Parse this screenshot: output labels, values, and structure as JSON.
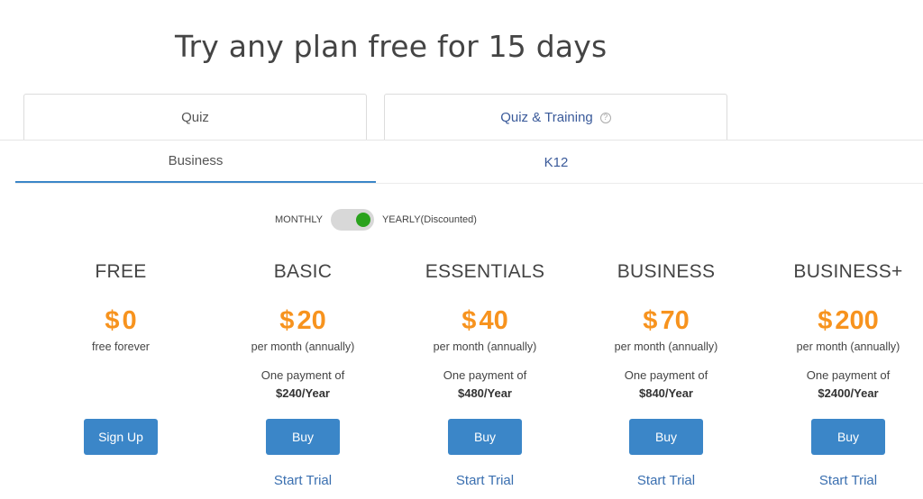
{
  "headline": "Try any plan free for 15 days",
  "product_tabs": [
    {
      "label": "Quiz",
      "active": true
    },
    {
      "label": "Quiz & Training",
      "help_icon": "question-circle-icon",
      "active": false
    }
  ],
  "segment_tabs": [
    {
      "label": "Business",
      "active": true
    },
    {
      "label": "K12",
      "active": false
    }
  ],
  "billing": {
    "monthly_label": "MONTHLY",
    "yearly_label": "YEARLY(Discounted)",
    "selected": "yearly"
  },
  "plans": [
    {
      "name": "FREE",
      "currency": "$",
      "price": "0",
      "period": "free forever",
      "payment_label": "",
      "total": "",
      "button": "Sign Up",
      "trial": ""
    },
    {
      "name": "BASIC",
      "currency": "$",
      "price": "20",
      "period": "per month (annually)",
      "payment_label": "One payment of",
      "total": "$240/Year",
      "button": "Buy",
      "trial": "Start Trial"
    },
    {
      "name": "ESSENTIALS",
      "currency": "$",
      "price": "40",
      "period": "per month (annually)",
      "payment_label": "One payment of",
      "total": "$480/Year",
      "button": "Buy",
      "trial": "Start Trial"
    },
    {
      "name": "BUSINESS",
      "currency": "$",
      "price": "70",
      "period": "per month (annually)",
      "payment_label": "One payment of",
      "total": "$840/Year",
      "button": "Buy",
      "trial": "Start Trial"
    },
    {
      "name": "BUSINESS+",
      "currency": "$",
      "price": "200",
      "period": "per month (annually)",
      "payment_label": "One payment of",
      "total": "$2400/Year",
      "button": "Buy",
      "trial": "Start Trial"
    }
  ],
  "colors": {
    "accent": "#3b86c8",
    "price": "#f7931e",
    "toggle_on": "#2aa21d",
    "link": "#3a6fb0"
  }
}
